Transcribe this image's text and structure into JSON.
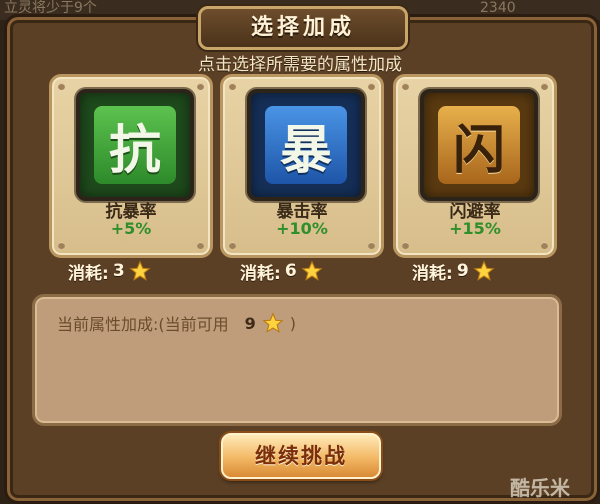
{
  "background": {
    "left_text": "立灵将少于9个",
    "right_text": "2340"
  },
  "dialog": {
    "title": "选择加成",
    "subtitle": "点击选择所需要的属性加成",
    "cards": [
      {
        "glyph": "抗",
        "name": "抗暴率",
        "bonus": "+5%",
        "color": "#3da93a",
        "cost_label": "消耗:",
        "cost_value": "3"
      },
      {
        "glyph": "暴",
        "name": "暴击率",
        "bonus": "+10%",
        "color": "#2f6fc6",
        "cost_label": "消耗:",
        "cost_value": "6"
      },
      {
        "glyph": "闪",
        "name": "闪避率",
        "bonus": "+15%",
        "color": "#c98a2e",
        "cost_label": "消耗:",
        "cost_value": "9"
      }
    ],
    "current_label": "当前属性加成:(当前可用",
    "current_available": "9",
    "current_close": ")",
    "continue_label": "继续挑战"
  },
  "watermark": "酷乐米"
}
